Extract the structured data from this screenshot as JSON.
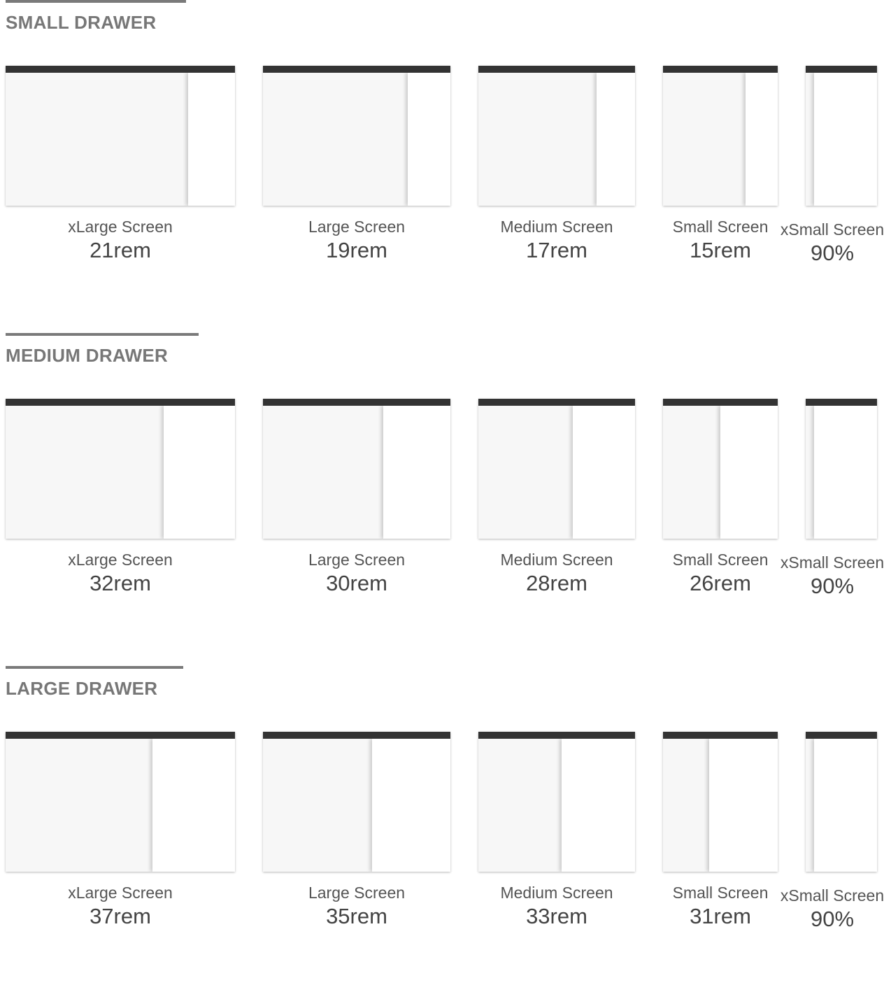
{
  "sections": [
    {
      "title": "SMALL DRAWER",
      "items": [
        {
          "screen": "xLarge Screen",
          "size": "21rem"
        },
        {
          "screen": "Large Screen",
          "size": "19rem"
        },
        {
          "screen": "Medium Screen",
          "size": "17rem"
        },
        {
          "screen": "Small Screen",
          "size": "15rem"
        },
        {
          "screen": "xSmall Screen",
          "size": "90%"
        }
      ]
    },
    {
      "title": "MEDIUM DRAWER",
      "items": [
        {
          "screen": "xLarge Screen",
          "size": "32rem"
        },
        {
          "screen": "Large Screen",
          "size": "30rem"
        },
        {
          "screen": "Medium Screen",
          "size": "28rem"
        },
        {
          "screen": "Small Screen",
          "size": "26rem"
        },
        {
          "screen": "xSmall Screen",
          "size": "90%"
        }
      ]
    },
    {
      "title": "LARGE DRAWER",
      "items": [
        {
          "screen": "xLarge Screen",
          "size": "37rem"
        },
        {
          "screen": "Large Screen",
          "size": "35rem"
        },
        {
          "screen": "Medium Screen",
          "size": "33rem"
        },
        {
          "screen": "Small Screen",
          "size": "31rem"
        },
        {
          "screen": "xSmall Screen",
          "size": "90%"
        }
      ]
    }
  ],
  "colors": {
    "frame_bar": "#333333",
    "backdrop": "#f7f7f7",
    "drawer": "#ffffff",
    "heading": "#777777",
    "rule": "#7a7a7a"
  }
}
